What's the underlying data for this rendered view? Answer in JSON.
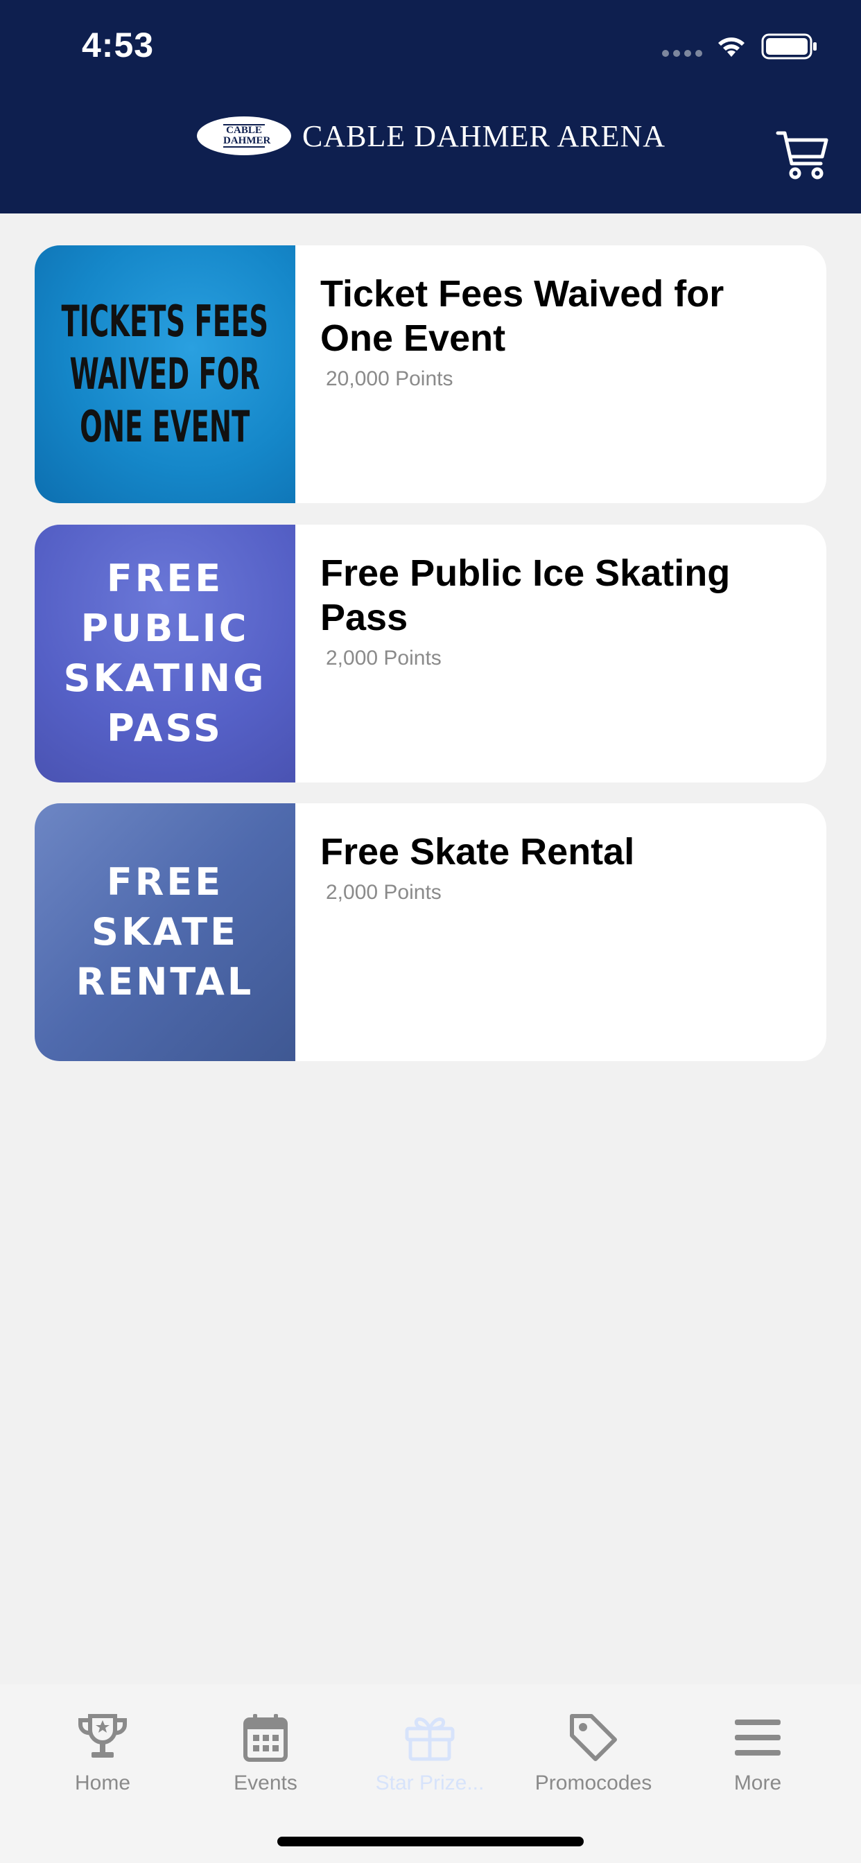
{
  "status_bar": {
    "time": "4:53"
  },
  "header": {
    "logo_badge_text": "CABLE DAHMER",
    "logo_text": "CABLE DAHMER ARENA",
    "cart_icon": "shopping-cart-icon",
    "background_color": "#0e1f4f"
  },
  "rewards": [
    {
      "image_text": "TICKETS FEES WAIVED FOR ONE EVENT",
      "title": "Ticket Fees Waived for One Event",
      "points": "20,000 Points"
    },
    {
      "image_text": "FREE PUBLIC SKATING PASS",
      "title": "Free Public Ice Skating Pass",
      "points": "2,000 Points"
    },
    {
      "image_text": "FREE SKATE RENTAL",
      "title": "Free Skate Rental",
      "points": "2,000 Points"
    }
  ],
  "tabbar": {
    "tabs": [
      {
        "label": "Home",
        "icon": "trophy-icon"
      },
      {
        "label": "Events",
        "icon": "calendar-icon"
      },
      {
        "label": "Star Prize...",
        "icon": "gift-icon",
        "active": true
      },
      {
        "label": "Promocodes",
        "icon": "tag-icon"
      },
      {
        "label": "More",
        "icon": "menu-icon"
      }
    ],
    "active_color": "#d7e3fb",
    "inactive_color": "#8a8a8a"
  }
}
